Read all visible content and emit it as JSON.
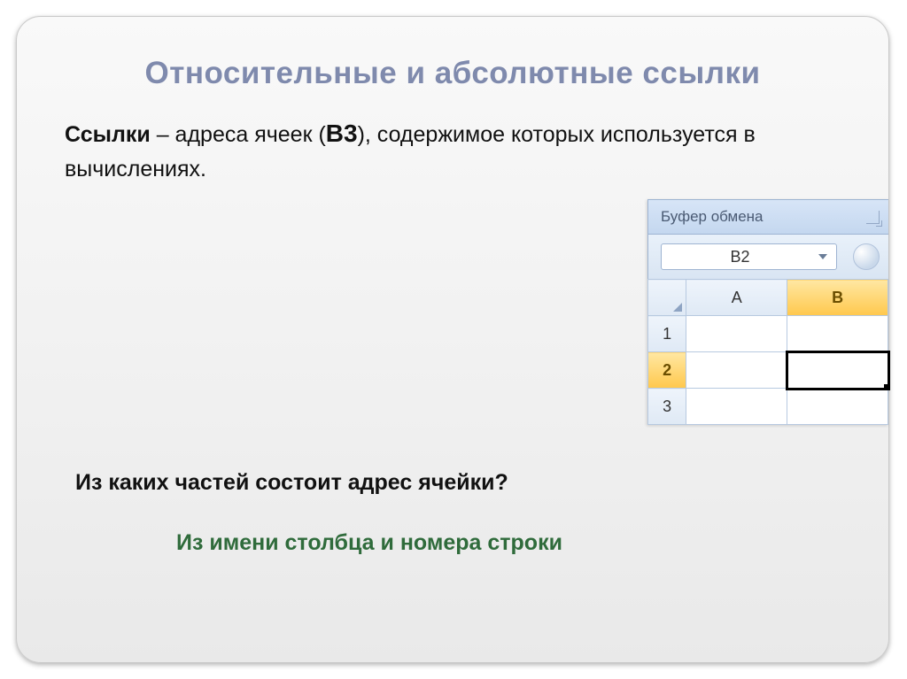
{
  "slide": {
    "title": "Относительные и абсолютные ссылки",
    "paragraph": {
      "bold_word": "Ссылки",
      "mid1": " – адреса ячеек (",
      "cell_ref": "В3",
      "mid2": "), содержимое которых используется в вычислениях."
    },
    "question": "Из каких частей состоит адрес ячейки?",
    "answer": "Из имени столбца и номера строки"
  },
  "excel": {
    "clipboard_label": "Буфер обмена",
    "name_box_value": "B2",
    "columns": [
      "A",
      "B"
    ],
    "rows": [
      "1",
      "2",
      "3"
    ],
    "active_column_index": 1,
    "active_row_index": 1
  }
}
